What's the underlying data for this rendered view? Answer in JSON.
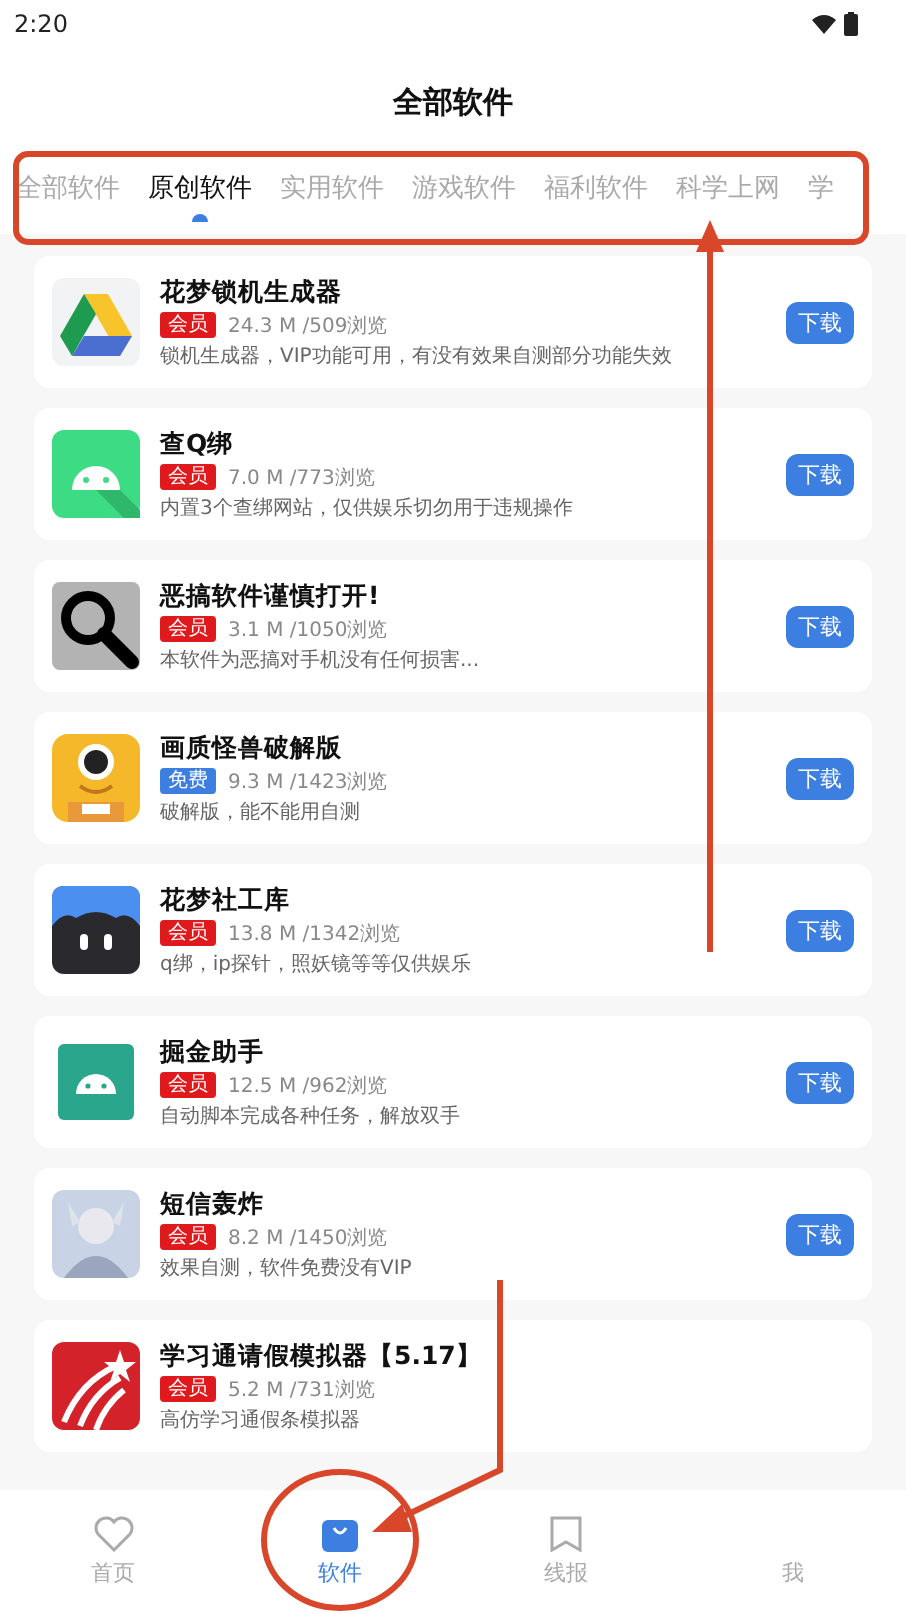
{
  "status_bar": {
    "time": "2:20"
  },
  "title": "全部软件",
  "tabs": [
    {
      "label": "全部软件",
      "selected": false
    },
    {
      "label": "原创软件",
      "selected": true
    },
    {
      "label": "实用软件",
      "selected": false
    },
    {
      "label": "游戏软件",
      "selected": false
    },
    {
      "label": "福利软件",
      "selected": false
    },
    {
      "label": "科学上网",
      "selected": false
    },
    {
      "label": "学",
      "selected": false
    }
  ],
  "apps": [
    {
      "kind": "drive",
      "name": "花梦锁机生成器",
      "badge": "会员",
      "color": "#e0191c",
      "meta": "24.3 M /509浏览",
      "desc": "锁机生成器，VIP功能可用，有没有效果自测部分功能失效",
      "button": "下载"
    },
    {
      "kind": "android-green",
      "name": "查Q绑",
      "badge": "会员",
      "color": "#e0191c",
      "meta": "7.0 M /773浏览",
      "desc": "内置3个查绑网站，仅供娱乐切勿用于违规操作",
      "button": "下载"
    },
    {
      "kind": "magnifier",
      "name": "恶搞软件谨慎打开!",
      "badge": "会员",
      "color": "#e0191c",
      "meta": "3.1 M /1050浏览",
      "desc": "本软件为恶搞对手机没有任何损害...",
      "button": "下载"
    },
    {
      "kind": "monster",
      "name": "画质怪兽破解版",
      "badge": "免费",
      "color": "#3d7fe0",
      "meta": "9.3 M /1423浏览",
      "desc": "破解版，能不能用自测",
      "button": "下载"
    },
    {
      "kind": "cat",
      "name": "花梦社工库",
      "badge": "会员",
      "color": "#e0191c",
      "meta": "13.8 M /1342浏览",
      "desc": "q绑，ip探针，照妖镜等等仅供娱乐",
      "button": "下载"
    },
    {
      "kind": "android-teal",
      "name": "掘金助手",
      "badge": "会员",
      "color": "#e0191c",
      "meta": "12.5 M /962浏览",
      "desc": "自动脚本完成各种任务，解放双手",
      "button": "下载"
    },
    {
      "kind": "avatar",
      "name": "短信轰炸",
      "badge": "会员",
      "color": "#e0191c",
      "meta": "8.2 M /1450浏览",
      "desc": "效果自测，软件免费没有VIP",
      "button": "下载"
    },
    {
      "kind": "star",
      "name": "学习通请假模拟器【5.17】",
      "badge": "会员",
      "color": "#e0191c",
      "meta": "5.2 M /731浏览",
      "desc": "高仿学习通假条模拟器"
    }
  ],
  "nav": [
    {
      "kind": "heart",
      "label": "首页",
      "selected": false
    },
    {
      "kind": "bag",
      "label": "软件",
      "selected": true
    },
    {
      "kind": "bookmark",
      "label": "线报",
      "selected": false
    },
    {
      "kind": "none",
      "label": "我",
      "selected": false
    }
  ]
}
